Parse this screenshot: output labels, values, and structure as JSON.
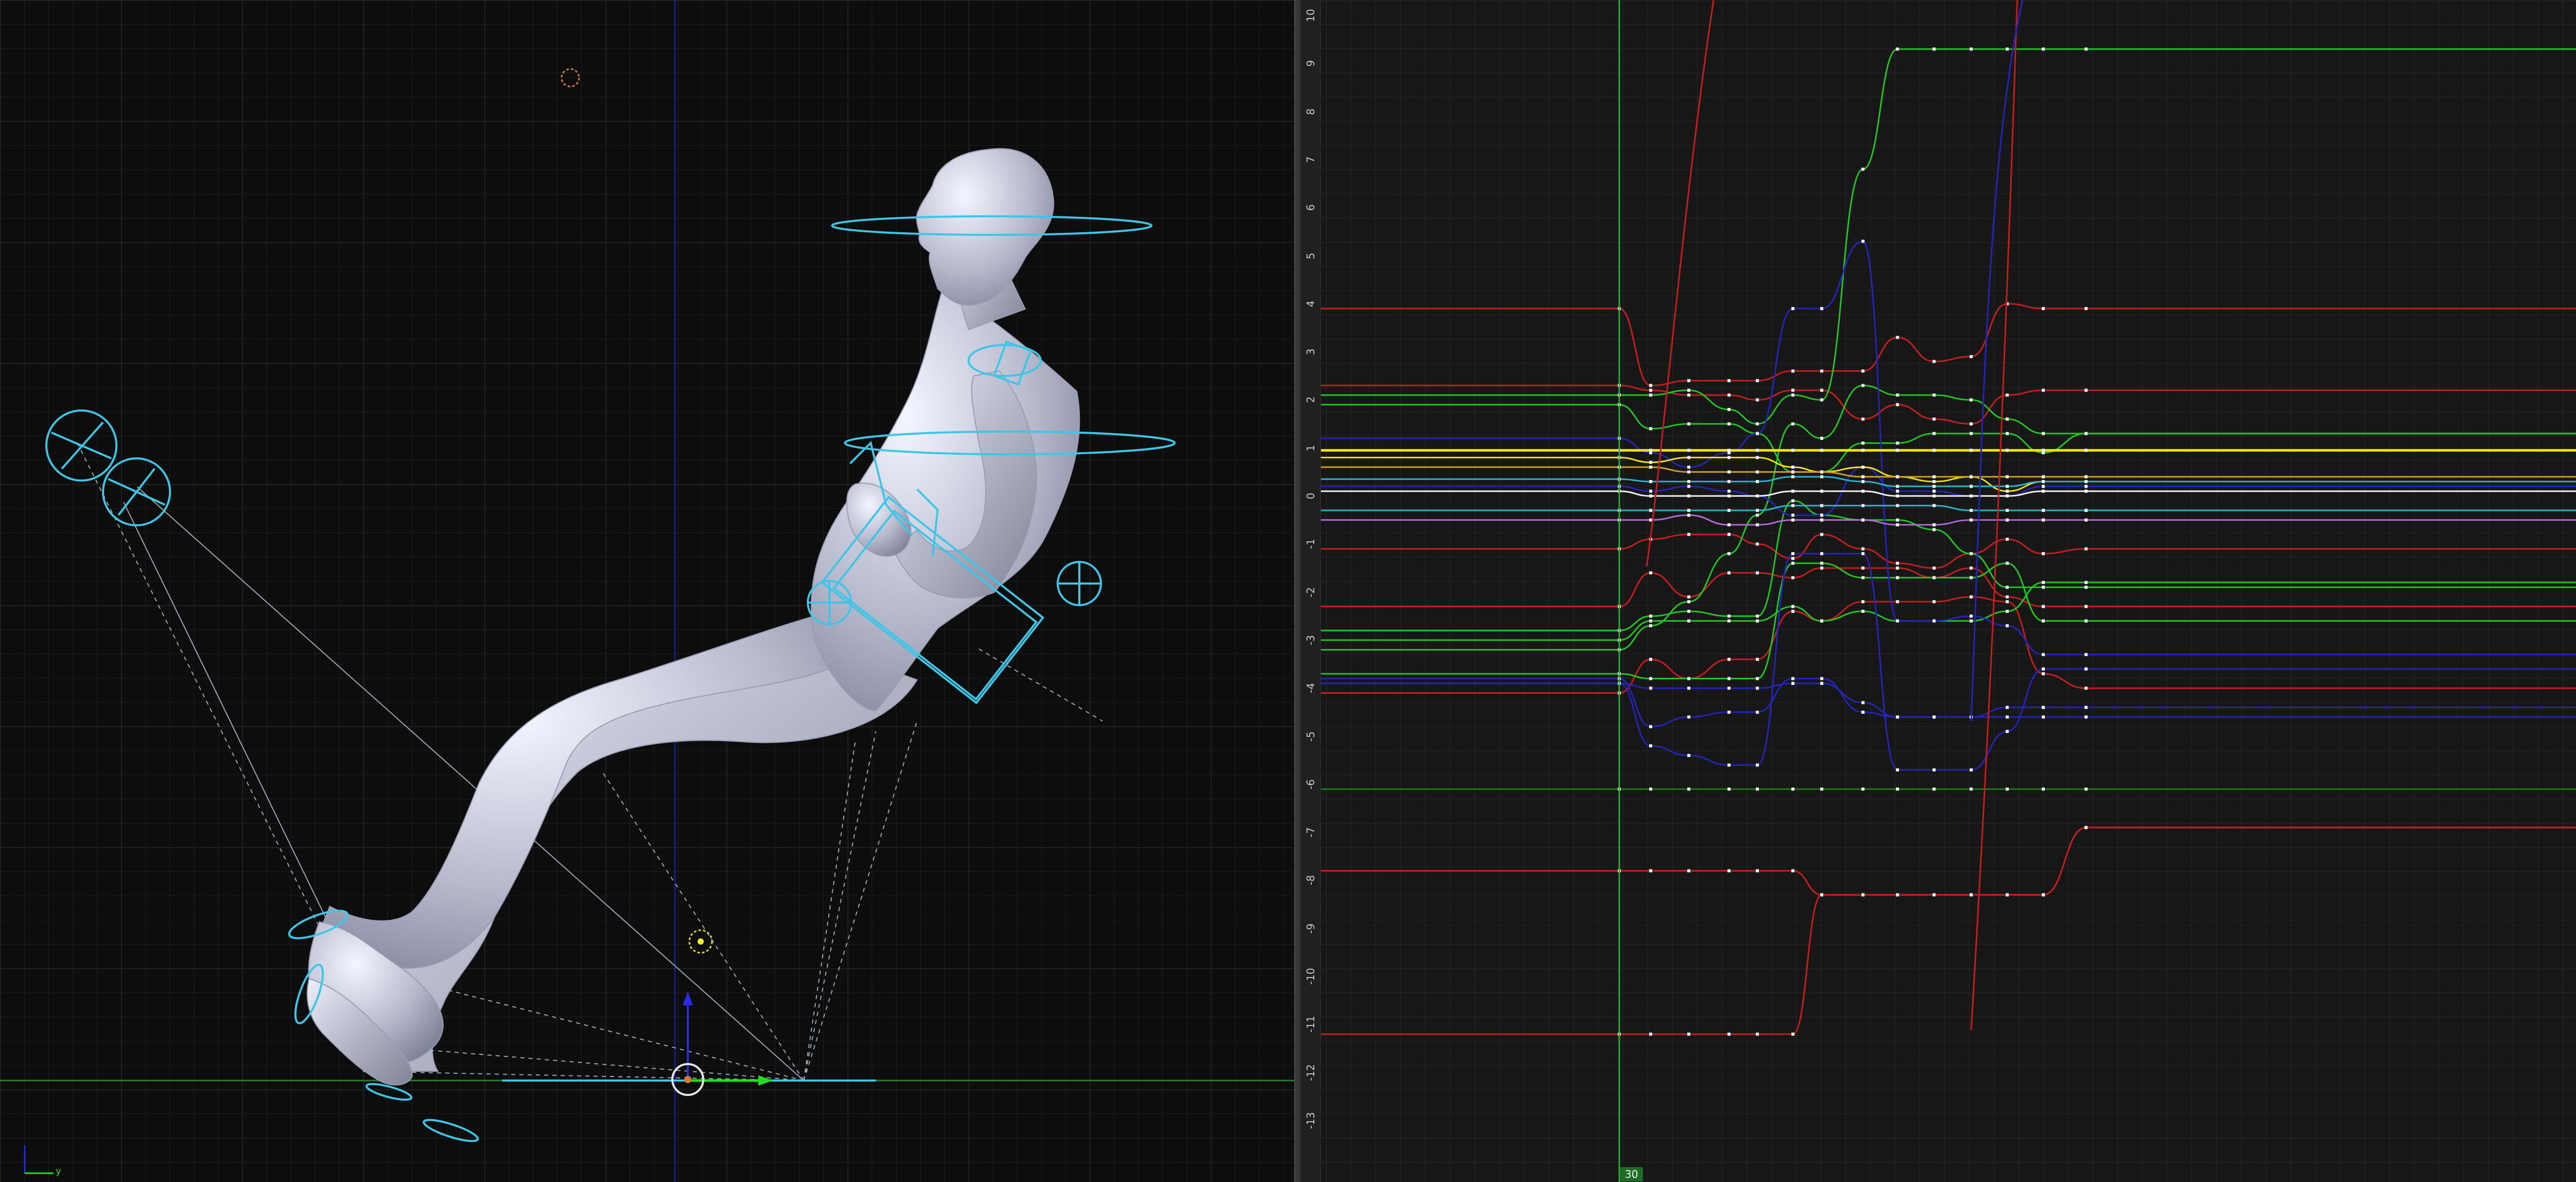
{
  "viewport": {
    "name": "3D viewport",
    "ground_axis": "y",
    "colors": {
      "bg": "#0d0d0d",
      "grid": "#1e1e1e",
      "rig": "#3fc6e6",
      "mesh": "#c9cbd8",
      "ground": "#2f7a2f",
      "blue_axis": "#1c1c8a"
    }
  },
  "graph_editor": {
    "value_ruler": [
      "10",
      "9",
      "8",
      "7",
      "6",
      "5",
      "4",
      "3",
      "2",
      "1",
      "0",
      "-1",
      "-2",
      "-3",
      "-4",
      "-5",
      "-6",
      "-7",
      "-8",
      "-9",
      "-10",
      "-11",
      "-12",
      "-13"
    ],
    "current_frame": "30",
    "colors": {
      "bg": "#171717",
      "grid": "#2a2a2a",
      "red": "#c41e1e",
      "green": "#23c323",
      "blue": "#2424b8",
      "yellow": "#f0e016",
      "cyan": "#2ab3c9",
      "white": "#f2f2f2",
      "playhead": "#2ea82e"
    }
  }
}
